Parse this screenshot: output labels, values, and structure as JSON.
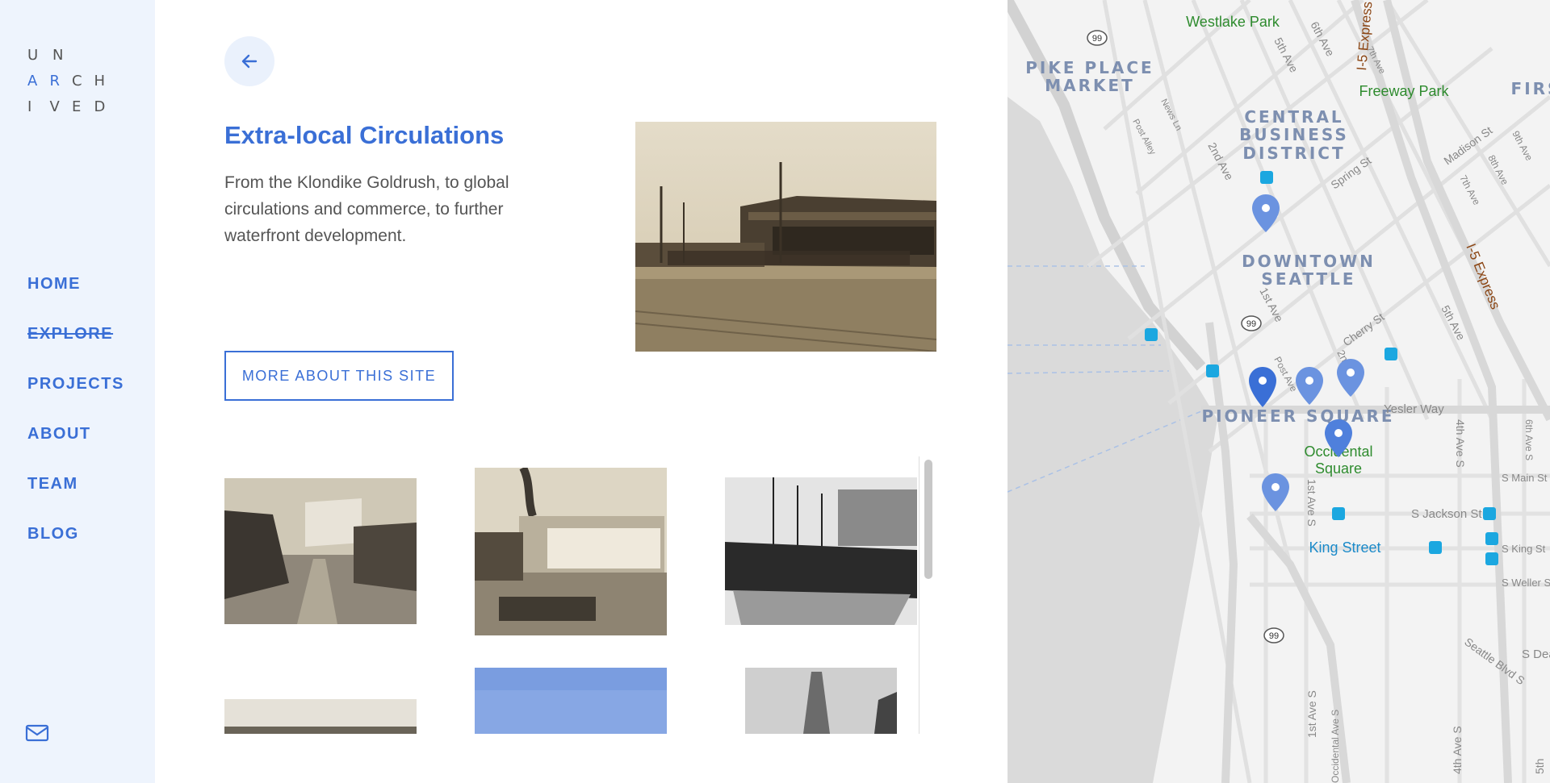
{
  "logo": {
    "rows": [
      [
        "U",
        "N",
        ""
      ],
      [
        "A",
        "R",
        "C",
        "H"
      ],
      [
        "I",
        "V",
        "E",
        "D"
      ]
    ]
  },
  "nav": {
    "items": [
      "HOME",
      "EXPLORE",
      "PROJECTS",
      "ABOUT",
      "TEAM",
      "BLOG"
    ],
    "active": "EXPLORE"
  },
  "icons": {
    "back": "arrow-left-icon",
    "mail": "mail-icon",
    "pin": "map-pin-icon",
    "transit": "transit-icon",
    "highway": "highway-shield-icon"
  },
  "colors": {
    "accent": "#3a6fd6",
    "sidebar_bg": "#eef4fd",
    "back_bg": "#eaf1fc",
    "text": "#555555",
    "pin": "#6b93e0",
    "pin_active": "#3a6fd6",
    "transit": "#1ba7e0",
    "park": "#2e8b2e",
    "water": "#d7d7d7"
  },
  "content": {
    "title": "Extra-local Circulations",
    "description": "From the Klondike Goldrush, to global circulations and commerce, to further waterfront development.",
    "more_button": "MORE ABOUT THIS SITE"
  },
  "map": {
    "neighborhoods": [
      [
        "PIKE PLACE",
        "MARKET"
      ],
      [
        "CENTRAL",
        "BUSINESS",
        "DISTRICT"
      ],
      [
        "DOWNTOWN",
        "SEATTLE"
      ],
      [
        "PIONEER SQUARE"
      ],
      [
        "FIRS"
      ]
    ],
    "parks": [
      "Westlake Park",
      "Freeway Park",
      "Occidental",
      "Square"
    ],
    "streets": [
      "5th Ave",
      "6th Ave",
      "7th Ave",
      "2nd Ave",
      "Post Alley",
      "News Ln",
      "Spring St",
      "Madison St",
      "9th Ave",
      "8th Ave",
      "7th Ave",
      "1st Ave",
      "Cherry St",
      "2nd Ave",
      "5th Ave",
      "Post Ave",
      "Yesler Way",
      "4th Ave S",
      "6th Ave S",
      "S Main St",
      "S Jackson St",
      "1st Ave S",
      "S King St",
      "S Weller St",
      "Seattle Blvd S",
      "S Dea",
      "1st Ave S",
      "Occidental Ave S",
      "4th Ave S",
      "5th"
    ],
    "highways": [
      "I-5 Express",
      "I-5 Express"
    ],
    "highway_shields": [
      "99",
      "99",
      "99"
    ],
    "transit": [
      "King Street"
    ]
  }
}
